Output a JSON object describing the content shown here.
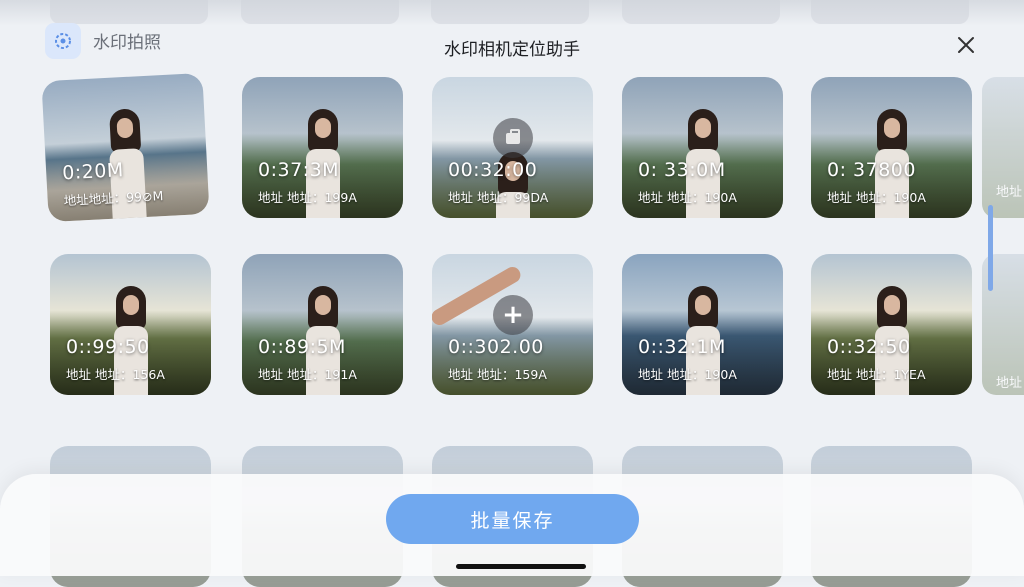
{
  "app": {
    "name": "水印拍照",
    "title": "水印相机定位助手"
  },
  "photos": [
    {
      "time": "0:20M",
      "address": "地址地址：99⊘M"
    },
    {
      "time": "0:37:3M",
      "address": "地址 地址：199A"
    },
    {
      "time": "00:32:00",
      "address": "地址 地址：99DA"
    },
    {
      "time": "0: 33:0M",
      "address": "地址 地址：190A"
    },
    {
      "time": "0: 37800",
      "address": "地址 地址：190A"
    },
    {
      "time": "0::99:50",
      "address": "地址 地址：156A"
    },
    {
      "time": "0::89:5M",
      "address": "地址 地址：191A"
    },
    {
      "time": "0::302.00",
      "address": "地址 地址：159A"
    },
    {
      "time": "0::32:1M",
      "address": "地址 地址：190A"
    },
    {
      "time": "0::32:50",
      "address": "地址 地址：1YEA"
    }
  ],
  "edge_texts": [
    "地址",
    "地址"
  ],
  "actions": {
    "batch_save": "批量保存"
  },
  "colors": {
    "accent": "#70a8ef",
    "logo_bg": "#dbe7fb"
  }
}
